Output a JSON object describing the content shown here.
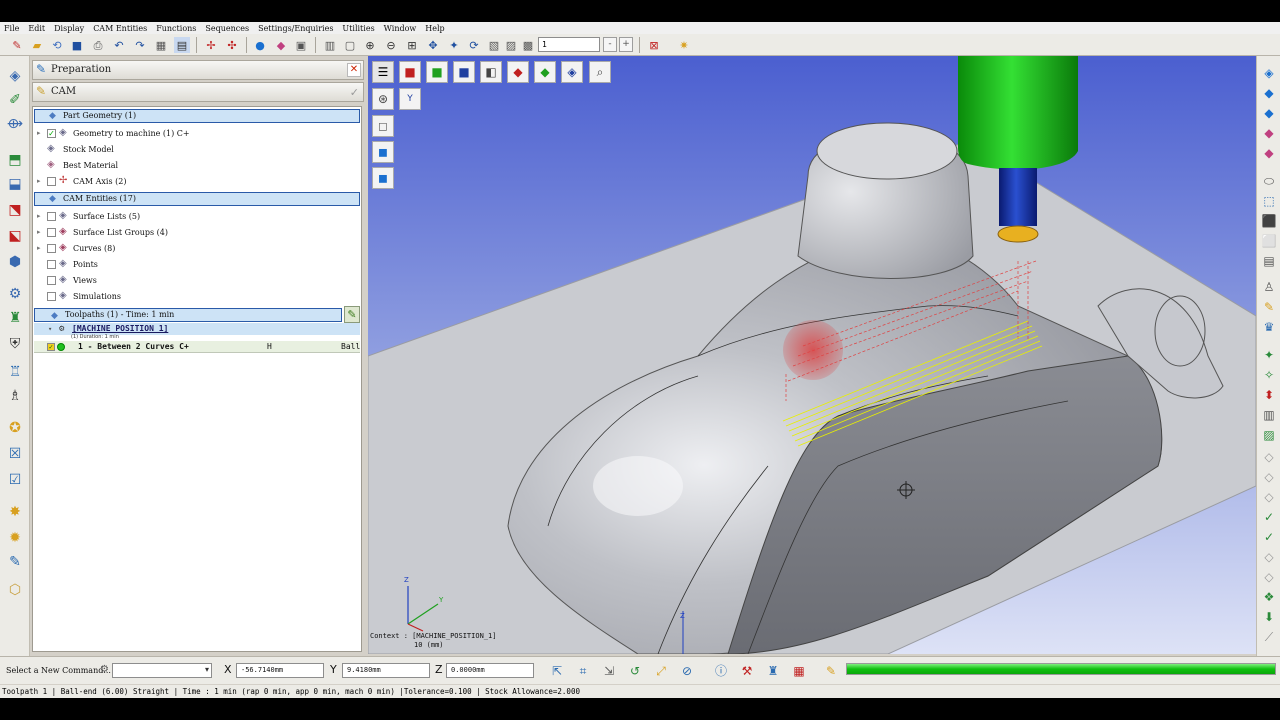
{
  "menu": [
    "File",
    "Edit",
    "Display",
    "CAM Entities",
    "Functions",
    "Sequences",
    "Settings/Enquiries",
    "Utilities",
    "Window",
    "Help"
  ],
  "toolbar": {
    "field_value": "1",
    "minus": "-",
    "plus": "+"
  },
  "panel": {
    "title": "Preparation",
    "mode": "CAM",
    "part_geometry": "Part Geometry (1)",
    "part_items": [
      {
        "label": "Geometry to machine (1) C+",
        "checked": true,
        "icon": "geometry-icon"
      },
      {
        "label": "Stock Model",
        "icon": "stock-icon"
      },
      {
        "label": "Best Material",
        "icon": "material-icon"
      },
      {
        "label": "CAM Axis (2)",
        "icon": "axis-icon"
      }
    ],
    "cam_entities": "CAM Entities (17)",
    "cam_items": [
      {
        "label": "Surface Lists (5)",
        "icon": "surface-list-icon"
      },
      {
        "label": "Surface List Groups (4)",
        "icon": "surface-group-icon"
      },
      {
        "label": "Curves (8)",
        "icon": "curves-icon"
      },
      {
        "label": "Points",
        "icon": "points-icon"
      },
      {
        "label": "Views",
        "icon": "views-icon"
      },
      {
        "label": "Simulations",
        "icon": "simulations-icon"
      }
    ],
    "toolpaths": "Toolpaths (1) - Time: 1 min",
    "machine_position": "[MACHINE POSITION 1]",
    "machine_duration": "(1) Duration: 1 min",
    "toolpath_row": {
      "name": "1 - Between 2 Curves C+",
      "col2": "H",
      "col3": "Ball-"
    }
  },
  "viewport": {
    "context_label": "Context : [MACHINE_POSITION_1]",
    "scale_label": "10 (mm)",
    "triad": {
      "z": "Z",
      "y": "Y",
      "x": "X"
    },
    "toolbar_icons": [
      "menu-icon",
      "view-front-icon",
      "view-side-icon",
      "view-top-icon",
      "view-iso-icon",
      "view-red-icon",
      "view-green-icon",
      "view-section-icon",
      "zoom-icon"
    ],
    "axis_toggle": "Y"
  },
  "commandbar": {
    "prompt": "Select a New Command...",
    "x_label": "X",
    "x_value": "-56.7140mm",
    "y_label": "Y",
    "y_value": "9.4180mm",
    "z_label": "Z",
    "z_value": "0.0000mm",
    "progress": 1.0
  },
  "status": "Toolpath 1 | Ball-end (6.00) Straight | Time : 1 min (rap 0 min, app 0 min, mach 0 min) |Tolerance=0.100 | Stock Allowance=2.000",
  "colors": {
    "viewport_top": "#4b5fd0",
    "viewport_bottom": "#dde2f6",
    "toolpath": "#e8f000",
    "tool_holder": "#18c018",
    "tool_shank": "#1030a0",
    "progress": "#10c010"
  }
}
